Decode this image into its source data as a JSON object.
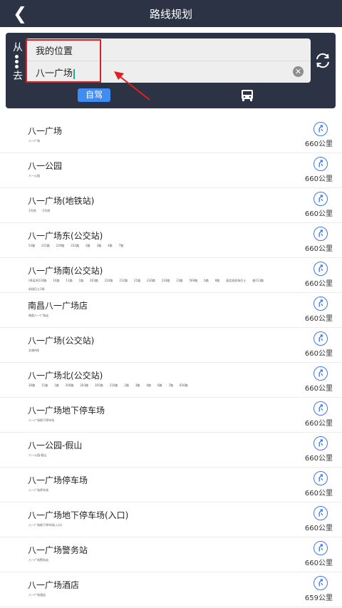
{
  "header": {
    "title": "路线规划",
    "back_icon": "chevron-left-icon"
  },
  "search": {
    "from_label": "从",
    "to_label": "去",
    "from_value": "我的位置",
    "to_value": "八一广场",
    "clear_icon": "clear-icon",
    "swap_icon": "swap-icon"
  },
  "modes": {
    "drive_label": "自驾",
    "bus_icon": "bus-icon"
  },
  "results": [
    {
      "name": "八一广场",
      "sub": [
        "八一广场"
      ],
      "dist": "660公里"
    },
    {
      "name": "八一公园",
      "sub": [
        "八一公园"
      ],
      "dist": "660公里"
    },
    {
      "name": "八一广场(地铁站)",
      "sub": [
        "1号线",
        "2号线"
      ],
      "dist": "660公里"
    },
    {
      "name": "八一广场东(公交站)",
      "sub": [
        "53路",
        "215路",
        "229路",
        "232路",
        "2路",
        "3路",
        "4路",
        "7路"
      ],
      "dist": "660公里"
    },
    {
      "name": "八一广场南(公交站)",
      "sub": [
        "(停运)K233路",
        "10路",
        "11路",
        "1路",
        "203路",
        "210路",
        "212路",
        "21路",
        "230路",
        "233路",
        "23路",
        "569路",
        "6路",
        "9路",
        "昌北班机场巴士",
        "夜213路"
      ],
      "sub2": [
        "机场巴士1线"
      ],
      "dist": "660公里"
    },
    {
      "name": "南昌八一广场店",
      "sub": [
        "南昌八一广场店"
      ],
      "dist": "660公里"
    },
    {
      "name": "八一广场(公交站)",
      "sub": [
        "文旅A线"
      ],
      "dist": "660公里"
    },
    {
      "name": "八一广场北(公交站)",
      "sub": [
        "30路",
        "11路",
        "1路",
        "200路",
        "203路",
        "305路",
        "210路",
        "2路",
        "3路",
        "4路",
        "6路",
        "7路",
        "816路"
      ],
      "dist": "660公里"
    },
    {
      "name": "八一广场地下停车场",
      "sub": [
        "八一广场地下停车场"
      ],
      "dist": "660公里"
    },
    {
      "name": "八一公园-假山",
      "sub": [
        "八一公园-假山"
      ],
      "dist": "660公里"
    },
    {
      "name": "八一广场停车场",
      "sub": [
        "八一广场停车场"
      ],
      "dist": "660公里"
    },
    {
      "name": "八一广场地下停车场(入口)",
      "sub": [
        "八一广场地下停车场(入口)"
      ],
      "dist": "660公里"
    },
    {
      "name": "八一广场警务站",
      "sub": [
        "八一广场警务站"
      ],
      "dist": "660公里"
    },
    {
      "name": "八一广场酒店",
      "sub": [
        "八一广场酒店"
      ],
      "dist": "659公里"
    }
  ],
  "colors": {
    "header_bg": "#2b3345",
    "accent": "#3f8cf5",
    "highlight": "#e02020",
    "nav_icon": "#3f78e8"
  }
}
